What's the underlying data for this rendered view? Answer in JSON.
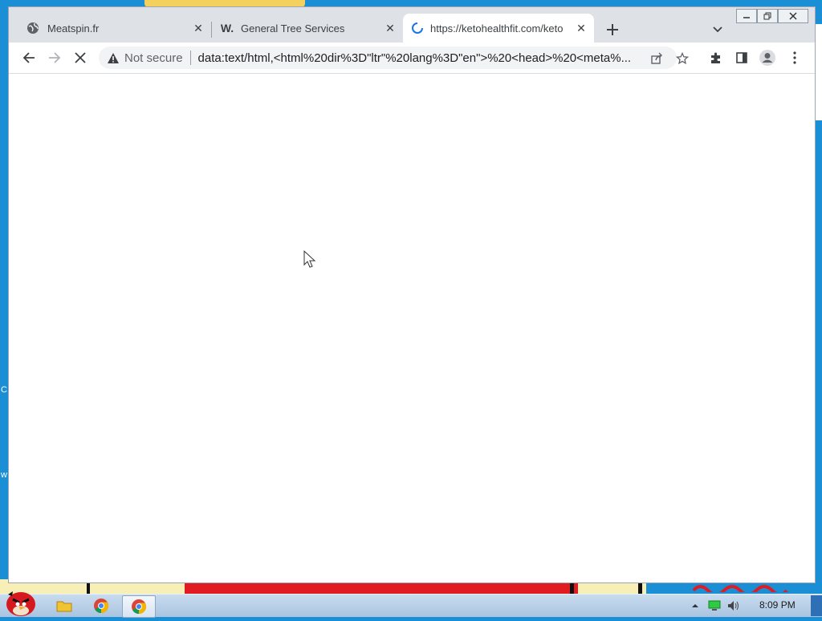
{
  "tabs": [
    {
      "title": "Meatspin.fr",
      "icon": "globe-icon"
    },
    {
      "title": "General Tree Services",
      "icon": "w-favicon",
      "favicon_text": "W."
    },
    {
      "title": "https://ketohealthfit.com/keto",
      "icon": "loading-spinner-icon",
      "active": true
    }
  ],
  "omnibox": {
    "security_label": "Not secure",
    "url_scheme": "data:",
    "url_rest": "text/html,<html%20dir%3D\"ltr\"%20lang%3D\"en\">%20<head>%20<meta%..."
  },
  "taskbar": {
    "time": "8:09 PM"
  },
  "desktop": {
    "left_letters": [
      "C",
      "w"
    ]
  },
  "colors": {
    "tabstrip": "#dee1e6",
    "omnibox": "#f1f3f4",
    "spinner": "#1a73e8",
    "desktop": "#1b8fd6"
  }
}
